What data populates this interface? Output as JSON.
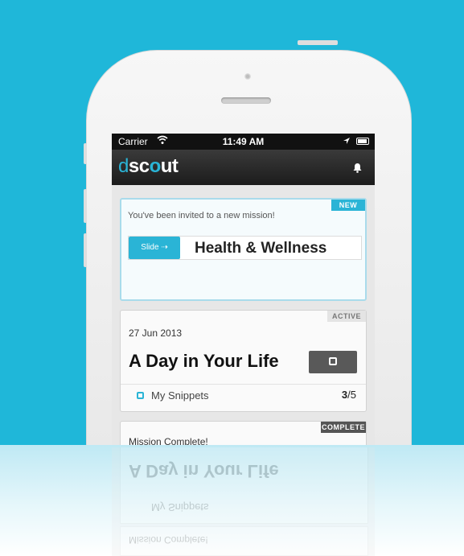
{
  "status": {
    "carrier": "Carrier",
    "time": "11:49 AM"
  },
  "app": {
    "logo_d": "d",
    "logo_sc": "sc",
    "logo_o": "o",
    "logo_ut": "ut"
  },
  "new_card": {
    "badge": "NEW",
    "invite_text": "You've been invited to a new mission!",
    "slide_label": "Slide",
    "mission_name": "Health & Wellness"
  },
  "active_card": {
    "badge": "ACTIVE",
    "date": "27 Jun 2013",
    "title": "A Day in Your Life",
    "snippets_label": "My Snippets",
    "snippets_done": "3",
    "snippets_total": "/5"
  },
  "complete_card": {
    "badge": "COMPLETE",
    "text": "Mission Complete!"
  },
  "colors": {
    "background": "#1fb7d9",
    "accent": "#2ab4d6",
    "navbar": "#1c1c1c"
  },
  "icons": [
    "wifi-icon",
    "location-arrow-icon",
    "battery-icon",
    "bell-icon",
    "chat-icon",
    "snippet-icon",
    "arrow-right-icon"
  ]
}
